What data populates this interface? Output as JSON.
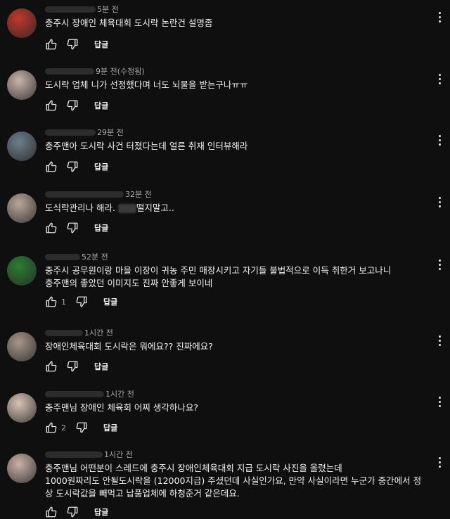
{
  "comments": [
    {
      "time": "5분 전",
      "text": [
        "충주시 장애인  체육대회 도시락 논란건 설명좀"
      ],
      "likes": "",
      "reply_label": "답글",
      "avatar_color": "#c0392b"
    },
    {
      "time": "9분 전(수정됨)",
      "text": [
        "도시락 업체 니가 선정했다며 너도 뇌물을 받는구나ㅠㅠ"
      ],
      "likes": "",
      "reply_label": "답글",
      "avatar_color": "#c9b3a8"
    },
    {
      "time": "29분 전",
      "text": [
        "충주맨아 도시락 사건 터졌다는데 얼른 취재 인터뷰해라"
      ],
      "likes": "",
      "reply_label": "답글",
      "avatar_color": "#6f7d8a"
    },
    {
      "time": "32분 전",
      "text_before_blur": "도식락관리나 해라. ",
      "text_after_blur": "떨지말고..",
      "likes": "",
      "reply_label": "답글",
      "avatar_color": "#b9a79a"
    },
    {
      "time": "52분 전",
      "text": [
        "충주시 공무원이랑 마을 이장이 귀농 주민 매장시키고 자기들 불법적으로 이득 취한거 보고나니",
        "충주맨의 좋았던 이미지도 진짜 안좋게 보이네"
      ],
      "likes": "1",
      "reply_label": "답글",
      "avatar_color": "#2e7d32"
    },
    {
      "time": "1시간 전",
      "text": [
        "장애인체육대회 도시락은 뭐에요?? 진짜에요?"
      ],
      "likes": "",
      "reply_label": "답글",
      "avatar_color": "#a8958a"
    },
    {
      "time": "1시간 전",
      "text": [
        "충주맨님 장애인 체육회 어찌 생각하나요?"
      ],
      "likes": "2",
      "reply_label": "답글",
      "avatar_color": "#d8c2b5"
    },
    {
      "time": "1시간 전",
      "text": [
        "충주맨님 어떤분이 스레드에 충주시 장애인체육대회 지급 도시락 사진을 올렸는데",
        "1000원짜리도 안될도시락을 (12000지급)  주셨던데 사실인가요, 만약 사실이라면 누군가 중간에서 정",
        "상 도시락값을 빼먹고 납품업체에 하청준거 같은데요."
      ],
      "likes": "",
      "reply_label": "답글",
      "avatar_color": "#c9b1a5"
    }
  ],
  "icons": {
    "like": "thumb-up-icon",
    "dislike": "thumb-down-icon",
    "more": "more-vert-icon"
  }
}
